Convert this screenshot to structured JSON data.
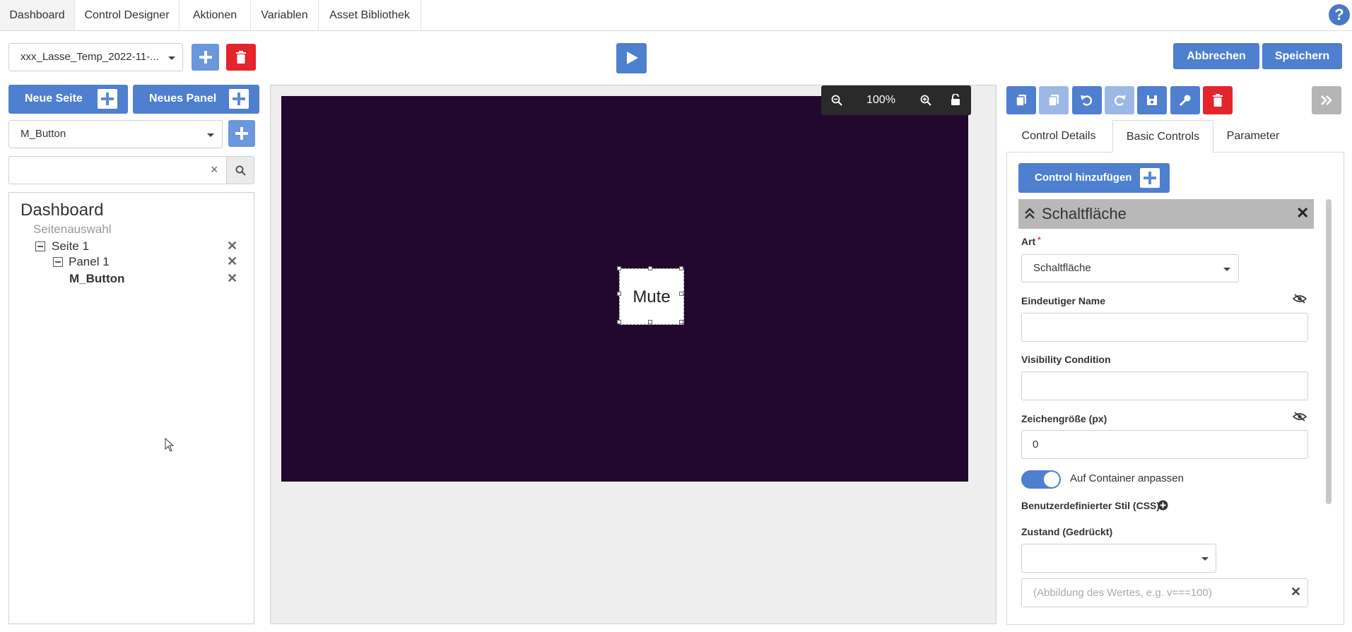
{
  "nav": {
    "tabs": [
      "Dashboard",
      "Control Designer",
      "Aktionen",
      "Variablen",
      "Asset Bibliothek"
    ],
    "active": "Dashboard"
  },
  "toolbar": {
    "project_select": "xxx_Lasse_Temp_2022-11-...",
    "cancel_label": "Abbrechen",
    "save_label": "Speichern"
  },
  "left": {
    "new_page_label": "Neue Seite",
    "new_panel_label": "Neues Panel",
    "control_select": "M_Button",
    "search_value": "",
    "tree": {
      "root": "Dashboard",
      "page_select_label": "Seitenauswahl",
      "page1": "Seite 1",
      "panel1": "Panel 1",
      "button": "M_Button"
    }
  },
  "canvas": {
    "zoom": "100%",
    "button_text": "Mute",
    "background": "#22082e"
  },
  "right": {
    "tabs": [
      "Control Details",
      "Basic Controls",
      "Parameter"
    ],
    "active_tab": "Basic Controls",
    "add_control_label": "Control hinzufügen",
    "section_title": "Schaltfläche",
    "art_label": "Art",
    "art_value": "Schaltfläche",
    "unique_name_label": "Eindeutiger Name",
    "unique_name_value": "",
    "visibility_label": "Visibility Condition",
    "visibility_value": "",
    "font_size_label": "Zeichengröße (px)",
    "font_size_value": "0",
    "fit_container_label": "Auf Container anpassen",
    "fit_container_on": true,
    "custom_css_label": "Benutzerdefinierter Stil (CSS)",
    "state_label": "Zustand (Gedrückt)",
    "state_value": "",
    "mapping_placeholder": "(Abbildung des Wertes, e.g. v===100)"
  },
  "colors": {
    "primary": "#4f7fcf",
    "danger": "#e3262b",
    "canvas": "#22082e"
  }
}
